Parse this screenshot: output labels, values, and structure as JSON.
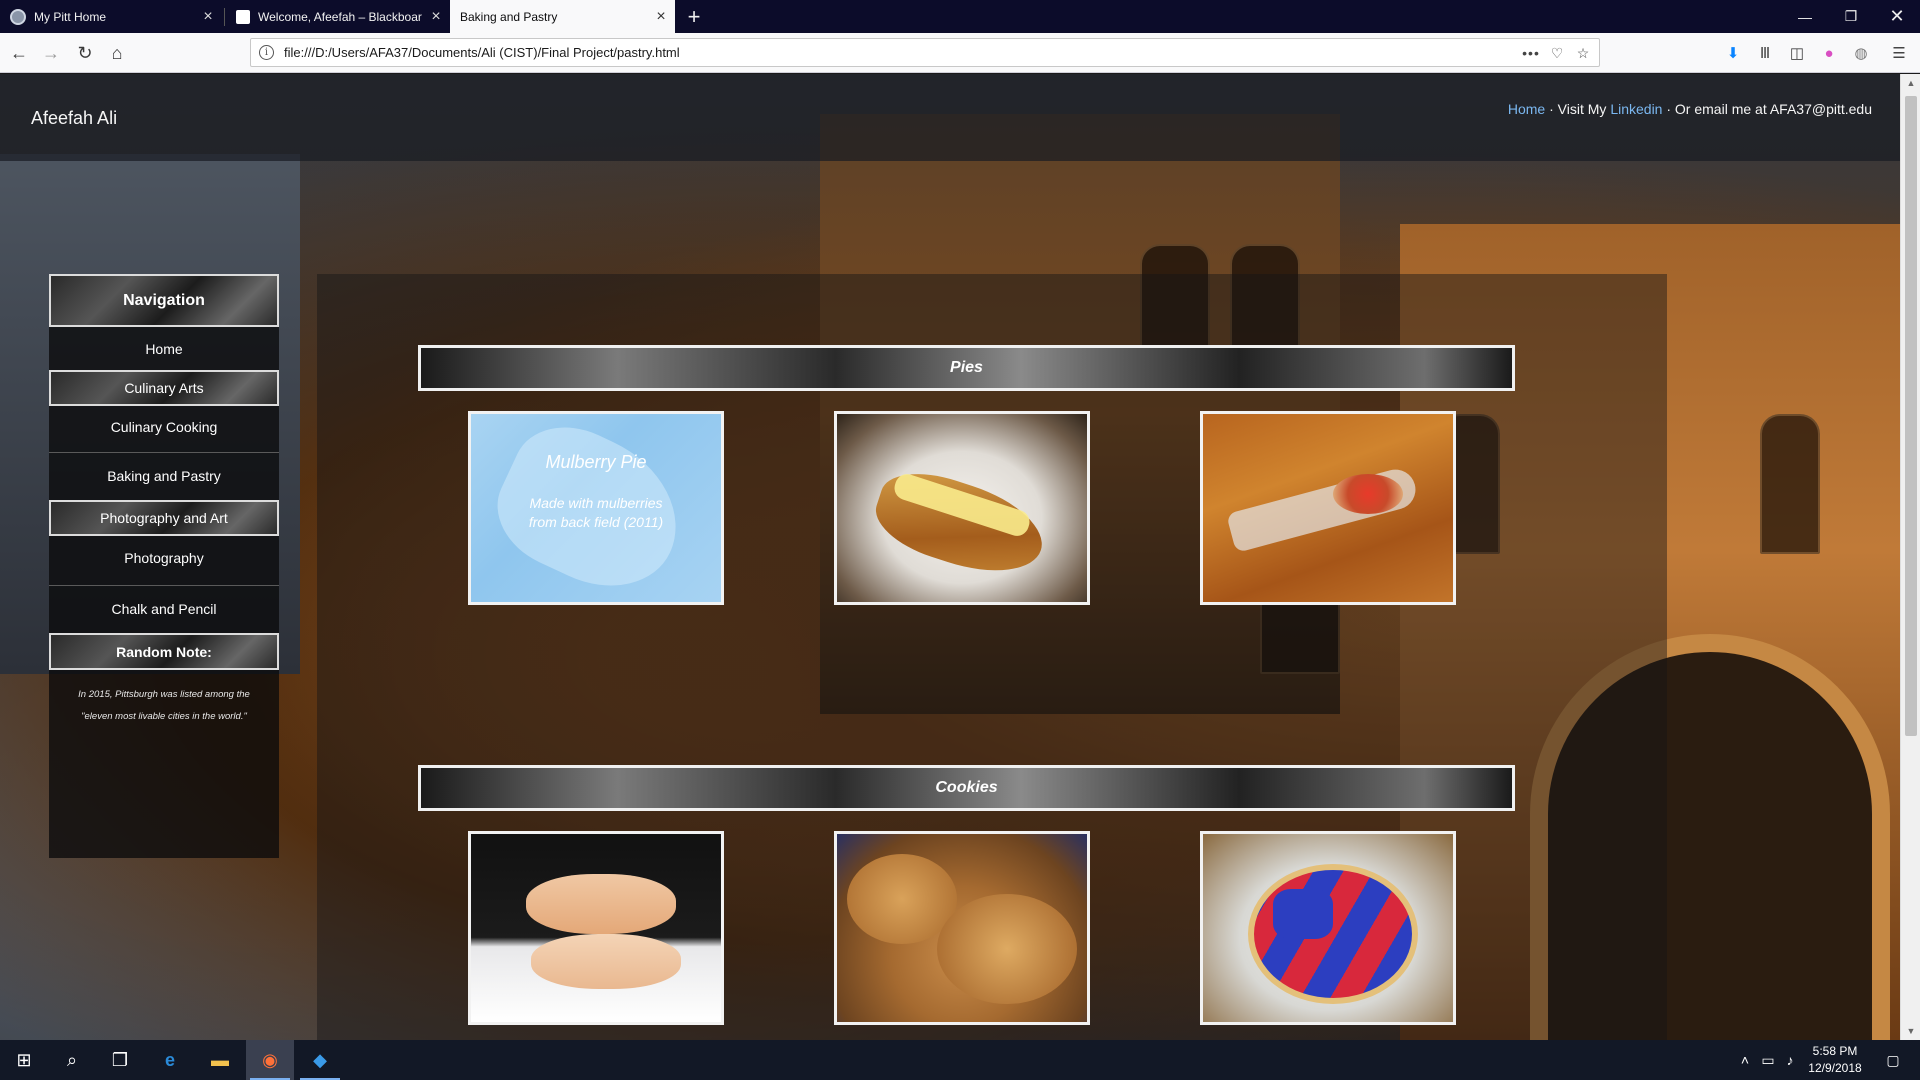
{
  "browser": {
    "tabs": [
      {
        "label": "My Pitt Home",
        "active": false
      },
      {
        "label": "Welcome, Afeefah – Blackboar",
        "active": false
      },
      {
        "label": "Baking and Pastry",
        "active": true
      }
    ],
    "new_tab": "+",
    "url": "file:///D:/Users/AFA37/Documents/Ali (CIST)/Final Project/pastry.html",
    "page_actions": "•••"
  },
  "header": {
    "site_name": "Afeefah Ali",
    "home_link": "Home",
    "separator1": " · Visit My ",
    "linkedin_link": "Linkedin",
    "separator2": " · Or email me at AFA37@pitt.edu"
  },
  "sidebar": {
    "nav_title": "Navigation",
    "home": "Home",
    "culinary_arts": "Culinary Arts",
    "culinary_cooking": "Culinary Cooking",
    "baking_pastry": "Baking and Pastry",
    "photography_art": "Photography and Art",
    "photography": "Photography",
    "chalk_pencil": "Chalk and Pencil",
    "random_note_title": "Random Note:",
    "random_note_line1": "In 2015, Pittsburgh was listed among the",
    "random_note_line2": "\"eleven most livable cities in the world.\""
  },
  "sections": {
    "pies": {
      "title": "Pies",
      "featured_caption_title": "Mulberry Pie",
      "featured_caption_desc": "Made with mulberries from back field (2011)"
    },
    "cookies": {
      "title": "Cookies"
    }
  },
  "taskbar": {
    "time": "5:58 PM",
    "date": "12/9/2018"
  }
}
